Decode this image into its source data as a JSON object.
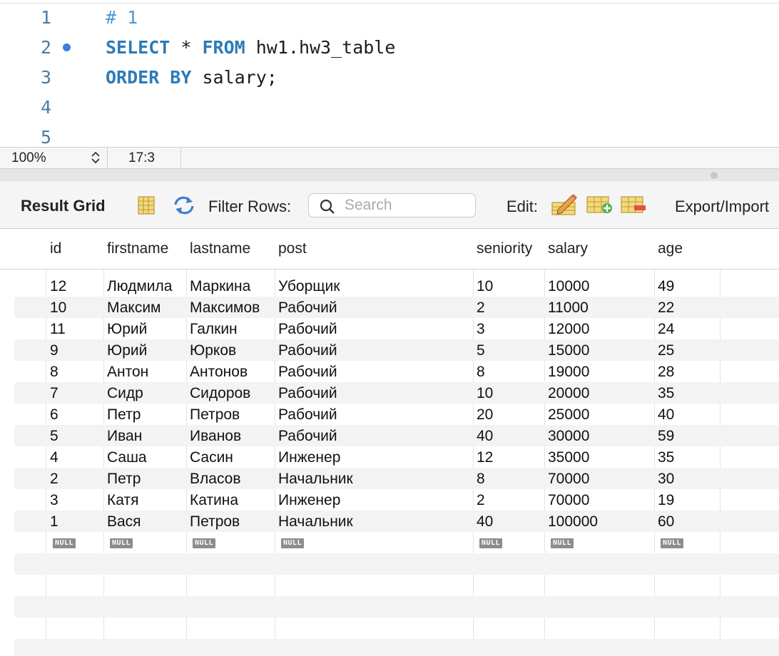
{
  "editor": {
    "lines": [
      {
        "num": "1",
        "comment": "# 1"
      },
      {
        "num": "2",
        "kw1": "SELECT",
        "t1": " * ",
        "kw2": "FROM",
        "t2": " hw1.hw3_table"
      },
      {
        "num": "3",
        "kw1": "ORDER BY",
        "t1": " salary;"
      },
      {
        "num": "4"
      },
      {
        "num": "5"
      }
    ]
  },
  "statusbar": {
    "zoom": "100%",
    "cursor": "17:3"
  },
  "toolbar": {
    "title": "Result Grid",
    "filter_label": "Filter Rows:",
    "search_placeholder": "Search",
    "edit_label": "Edit:",
    "export_label": "Export/Import"
  },
  "grid": {
    "columns": [
      "id",
      "firstname",
      "lastname",
      "post",
      "seniority",
      "salary",
      "age"
    ],
    "rows": [
      [
        "12",
        "Людмила",
        "Маркина",
        "Уборщик",
        "10",
        "10000",
        "49"
      ],
      [
        "10",
        "Максим",
        "Максимов",
        "Рабочий",
        "2",
        "11000",
        "22"
      ],
      [
        "11",
        "Юрий",
        "Галкин",
        "Рабочий",
        "3",
        "12000",
        "24"
      ],
      [
        "9",
        "Юрий",
        "Юрков",
        "Рабочий",
        "5",
        "15000",
        "25"
      ],
      [
        "8",
        "Антон",
        "Антонов",
        "Рабочий",
        "8",
        "19000",
        "28"
      ],
      [
        "7",
        "Сидр",
        "Сидоров",
        "Рабочий",
        "10",
        "20000",
        "35"
      ],
      [
        "6",
        "Петр",
        "Петров",
        "Рабочий",
        "20",
        "25000",
        "40"
      ],
      [
        "5",
        "Иван",
        "Иванов",
        "Рабочий",
        "40",
        "30000",
        "59"
      ],
      [
        "4",
        "Саша",
        "Сасин",
        "Инженер",
        "12",
        "35000",
        "35"
      ],
      [
        "2",
        "Петр",
        "Власов",
        "Начальник",
        "8",
        "70000",
        "30"
      ],
      [
        "3",
        "Катя",
        "Катина",
        "Инженер",
        "2",
        "70000",
        "19"
      ],
      [
        "1",
        "Вася",
        "Петров",
        "Начальник",
        "40",
        "100000",
        "60"
      ]
    ],
    "null_label": "NULL"
  },
  "colors": {
    "keyword": "#2b7bb9",
    "line_number": "#4d7ba1",
    "breakpoint": "#3a7fdc",
    "null_badge": "#8c8c8c"
  }
}
